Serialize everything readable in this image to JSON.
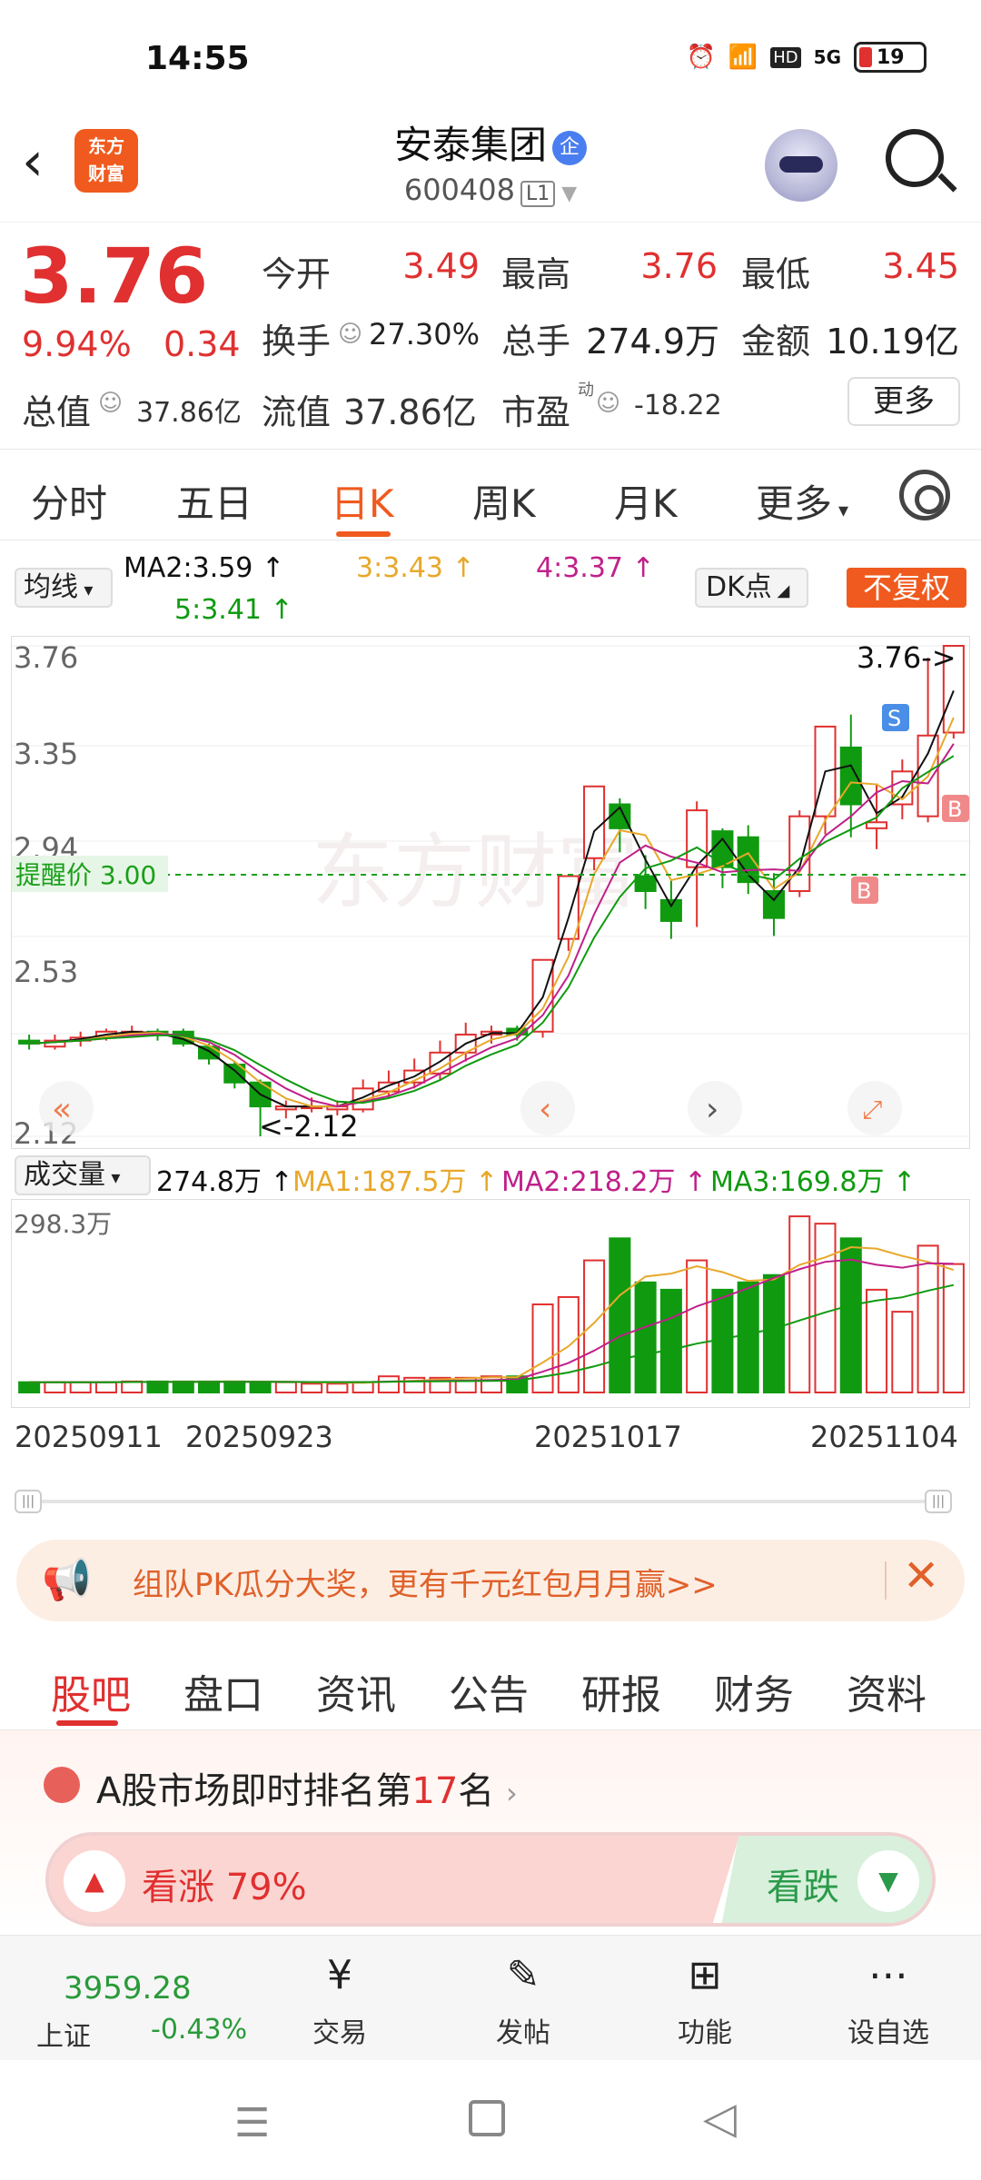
{
  "status_bar": {
    "time": "14:55",
    "battery": "19",
    "network": "5G",
    "hd": "HD"
  },
  "header": {
    "logo_line1": "东方",
    "logo_line2": "财富",
    "stock_name": "安泰集团",
    "badge": "企",
    "code": "600408",
    "level": "L1"
  },
  "quote": {
    "price": "3.76",
    "pct": "9.94%",
    "change": "0.34",
    "open_label": "今开",
    "open": "3.49",
    "high_label": "最高",
    "high": "3.76",
    "low_label": "最低",
    "low": "3.45",
    "turnover_label": "换手",
    "turnover": "27.30%",
    "volume_label": "总手",
    "volume": "274.9万",
    "amount_label": "金额",
    "amount": "10.19亿",
    "mcap_label": "总值",
    "mcap": "37.86亿",
    "float_label": "流值",
    "float_cap": "37.86亿",
    "pe_label": "市盈",
    "pe_sup": "动",
    "pe": "-18.22",
    "more": "更多"
  },
  "period_tabs": [
    "分时",
    "五日",
    "日K",
    "周K",
    "月K",
    "更多"
  ],
  "active_period": "日K",
  "ma_legend": {
    "selector": "均线",
    "ma2": "MA2:3.59",
    "ma3": "3:3.43",
    "ma4": "4:3.37",
    "ma5": "5:3.41",
    "dk_button": "DK点",
    "fq_button": "不复权"
  },
  "k_axis": {
    "max": "3.76",
    "t2": "3.35",
    "t3": "2.94",
    "t4": "2.53",
    "min": "2.12"
  },
  "annotations": {
    "high_label": "3.76->",
    "low_label": "<-2.12",
    "alert": "提醒价 3.00",
    "s": "S",
    "b": "B"
  },
  "watermark": "东方财富",
  "vol_legend": {
    "selector": "成交量",
    "vol": "274.8万",
    "ma1": "MA1:187.5万",
    "ma2": "MA2:218.2万",
    "ma3": "MA3:169.8万",
    "axis_max": "298.3万"
  },
  "dates": [
    "20250911",
    "20250923",
    "20251017",
    "20251104"
  ],
  "chart_data": {
    "type": "candlestick",
    "ylim": [
      2.12,
      3.76
    ],
    "candles": [
      {
        "o": 2.44,
        "c": 2.43,
        "h": 2.46,
        "l": 2.41
      },
      {
        "o": 2.42,
        "c": 2.44,
        "h": 2.46,
        "l": 2.41
      },
      {
        "o": 2.44,
        "c": 2.45,
        "h": 2.47,
        "l": 2.42
      },
      {
        "o": 2.45,
        "c": 2.47,
        "h": 2.48,
        "l": 2.44
      },
      {
        "o": 2.47,
        "c": 2.47,
        "h": 2.49,
        "l": 2.45
      },
      {
        "o": 2.47,
        "c": 2.46,
        "h": 2.48,
        "l": 2.44
      },
      {
        "o": 2.47,
        "c": 2.43,
        "h": 2.48,
        "l": 2.42
      },
      {
        "o": 2.42,
        "c": 2.38,
        "h": 2.43,
        "l": 2.36
      },
      {
        "o": 2.36,
        "c": 2.3,
        "h": 2.37,
        "l": 2.28
      },
      {
        "o": 2.3,
        "c": 2.22,
        "h": 2.31,
        "l": 2.12
      },
      {
        "o": 2.21,
        "c": 2.22,
        "h": 2.24,
        "l": 2.18
      },
      {
        "o": 2.22,
        "c": 2.22,
        "h": 2.25,
        "l": 2.2
      },
      {
        "o": 2.21,
        "c": 2.22,
        "h": 2.24,
        "l": 2.19
      },
      {
        "o": 2.21,
        "c": 2.28,
        "h": 2.31,
        "l": 2.2
      },
      {
        "o": 2.27,
        "c": 2.3,
        "h": 2.34,
        "l": 2.25
      },
      {
        "o": 2.3,
        "c": 2.34,
        "h": 2.38,
        "l": 2.28
      },
      {
        "o": 2.33,
        "c": 2.4,
        "h": 2.44,
        "l": 2.31
      },
      {
        "o": 2.4,
        "c": 2.46,
        "h": 2.5,
        "l": 2.37
      },
      {
        "o": 2.46,
        "c": 2.47,
        "h": 2.49,
        "l": 2.43
      },
      {
        "o": 2.48,
        "c": 2.46,
        "h": 2.49,
        "l": 2.44
      },
      {
        "o": 2.47,
        "c": 2.71,
        "h": 2.71,
        "l": 2.45
      },
      {
        "o": 2.78,
        "c": 2.99,
        "h": 2.99,
        "l": 2.74
      },
      {
        "o": 3.05,
        "c": 3.29,
        "h": 3.29,
        "l": 3.01
      },
      {
        "o": 3.23,
        "c": 3.15,
        "h": 3.25,
        "l": 3.07
      },
      {
        "o": 2.99,
        "c": 2.94,
        "h": 3.06,
        "l": 2.88
      },
      {
        "o": 2.91,
        "c": 2.84,
        "h": 2.98,
        "l": 2.78
      },
      {
        "o": 3.02,
        "c": 3.21,
        "h": 3.24,
        "l": 2.82
      },
      {
        "o": 3.14,
        "c": 3.02,
        "h": 3.15,
        "l": 2.95
      },
      {
        "o": 3.12,
        "c": 2.97,
        "h": 3.16,
        "l": 2.93
      },
      {
        "o": 2.94,
        "c": 2.85,
        "h": 3.0,
        "l": 2.79
      },
      {
        "o": 2.94,
        "c": 3.19,
        "h": 3.21,
        "l": 2.92
      },
      {
        "o": 3.19,
        "c": 3.49,
        "h": 3.49,
        "l": 3.13
      },
      {
        "o": 3.42,
        "c": 3.23,
        "h": 3.53,
        "l": 3.12
      },
      {
        "o": 3.15,
        "c": 3.17,
        "h": 3.3,
        "l": 3.08
      },
      {
        "o": 3.23,
        "c": 3.34,
        "h": 3.38,
        "l": 3.18
      },
      {
        "o": 3.19,
        "c": 3.46,
        "h": 3.72,
        "l": 3.17
      },
      {
        "o": 3.47,
        "c": 3.76,
        "h": 3.76,
        "l": 3.45
      }
    ],
    "volume": [
      14,
      14,
      14,
      14,
      15,
      15,
      15,
      15,
      15,
      14,
      14,
      12,
      12,
      14,
      22,
      20,
      20,
      20,
      22,
      22,
      120,
      130,
      180,
      210,
      150,
      140,
      180,
      140,
      150,
      160,
      240,
      230,
      210,
      140,
      110,
      200,
      175
    ]
  }
}
